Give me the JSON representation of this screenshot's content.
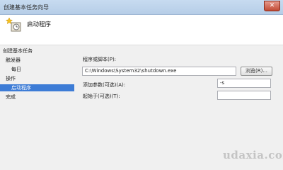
{
  "window": {
    "title": "创建基本任务向导",
    "close_symbol": "✕"
  },
  "header": {
    "title": "启动程序",
    "icon": "task-wizard-icon"
  },
  "nav": {
    "section_label": "创建基本任务",
    "items": [
      {
        "label": "触发器",
        "selected": false
      },
      {
        "label": "每日",
        "selected": false
      },
      {
        "label": "操作",
        "selected": false
      },
      {
        "label": "启动程序",
        "selected": true
      },
      {
        "label": "完成",
        "selected": false
      }
    ]
  },
  "form": {
    "program_label": "程序或脚本(P):",
    "program_value": "C:\\Windows\\System32\\shutdown.exe",
    "browse_label": "浏览(R)...",
    "args_label": "添加参数(可选)(A):",
    "args_value": "-s",
    "start_in_label": "起始于(可选)(T):",
    "start_in_value": ""
  },
  "watermark": "udaxia.com",
  "colors": {
    "selection": "#3d7cd6",
    "titlebar": "#c7dbf0"
  }
}
